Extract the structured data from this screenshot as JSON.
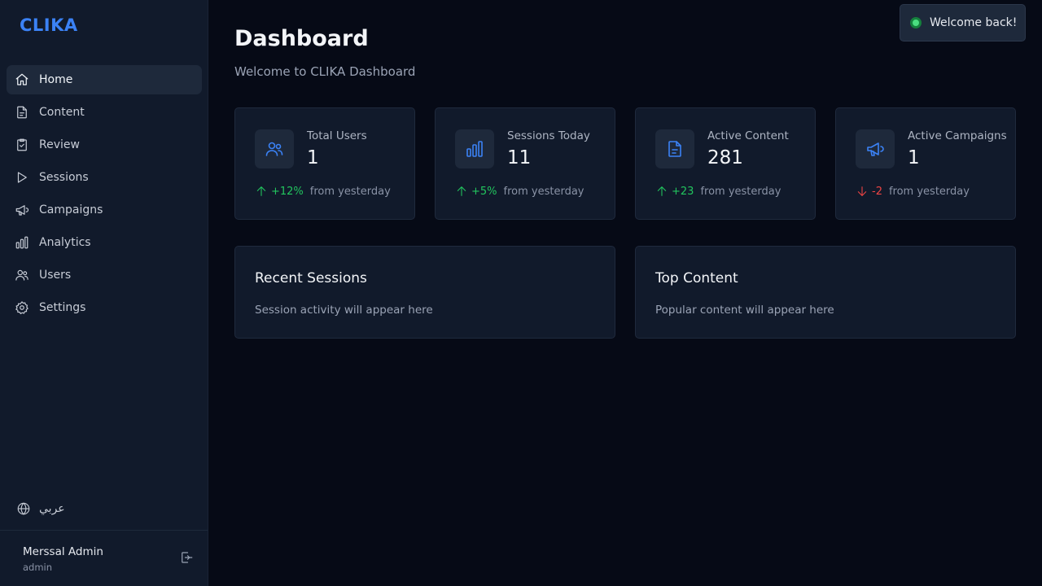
{
  "app": {
    "logo": "CLIKA"
  },
  "sidebar": {
    "items": [
      {
        "label": "Home",
        "icon": "home-icon",
        "active": true
      },
      {
        "label": "Content",
        "icon": "file-icon"
      },
      {
        "label": "Review",
        "icon": "clipboard-check-icon"
      },
      {
        "label": "Sessions",
        "icon": "play-icon"
      },
      {
        "label": "Campaigns",
        "icon": "megaphone-icon"
      },
      {
        "label": "Analytics",
        "icon": "bar-chart-icon"
      },
      {
        "label": "Users",
        "icon": "users-icon"
      },
      {
        "label": "Settings",
        "icon": "gear-icon"
      }
    ],
    "language": "عربي",
    "user": {
      "name": "Merssal Admin",
      "role": "admin"
    }
  },
  "header": {
    "title": "Dashboard",
    "subtitle": "Welcome to CLIKA Dashboard"
  },
  "stats": [
    {
      "label": "Total Users",
      "value": "1",
      "change": "+12%",
      "direction": "up",
      "note": "from yesterday",
      "icon": "users-icon"
    },
    {
      "label": "Sessions Today",
      "value": "11",
      "change": "+5%",
      "direction": "up",
      "note": "from yesterday",
      "icon": "bar-chart-icon"
    },
    {
      "label": "Active Content",
      "value": "281",
      "change": "+23",
      "direction": "up",
      "note": "from yesterday",
      "icon": "file-icon"
    },
    {
      "label": "Active Campaigns",
      "value": "1",
      "change": "-2",
      "direction": "down",
      "note": "from yesterday",
      "icon": "megaphone-icon"
    }
  ],
  "panels": {
    "recent_sessions": {
      "title": "Recent Sessions",
      "body": "Session activity will appear here"
    },
    "top_content": {
      "title": "Top Content",
      "body": "Popular content will appear here"
    }
  },
  "toast": {
    "text": "Welcome back!"
  },
  "colors": {
    "accent": "#3b82f6",
    "background": "#060a16",
    "sidebar": "#111a2b",
    "positive": "#22c55e",
    "negative": "#ef4444"
  }
}
